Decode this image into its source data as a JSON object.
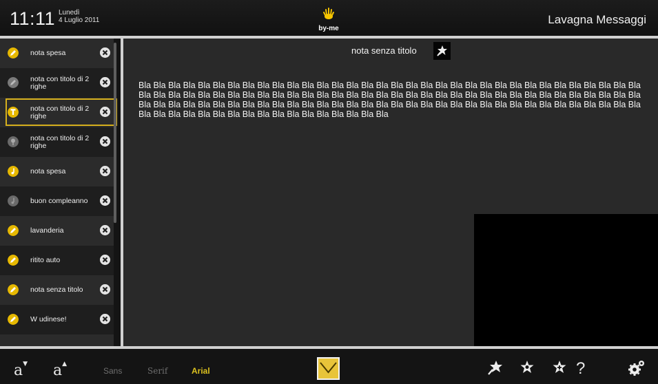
{
  "header": {
    "time": "11:11",
    "day": "Lunedì",
    "date": "4 Luglio 2011",
    "logo_text": "by-me",
    "title": "Lavagna Messaggi"
  },
  "sidebar": {
    "notes": [
      {
        "label": "nota spesa",
        "icon": "pencil-icon",
        "icon_color": "#e6b800"
      },
      {
        "label": "nota con titolo di 2 righe",
        "icon": "pencil-icon",
        "icon_color": "#7a7a7a"
      },
      {
        "label": "nota con titolo di 2 righe",
        "icon": "text-T-icon",
        "icon_color": "#e6b800",
        "selected": true
      },
      {
        "label": "nota con titolo di 2 righe",
        "icon": "pin-icon",
        "icon_color": "#6a6a6a"
      },
      {
        "label": "nota spesa",
        "icon": "music-note-icon",
        "icon_color": "#e6b800"
      },
      {
        "label": "buon compleanno",
        "icon": "music-note-icon",
        "icon_color": "#6a6a6a"
      },
      {
        "label": "lavanderia",
        "icon": "pencil-icon",
        "icon_color": "#e6b800"
      },
      {
        "label": "ritito auto",
        "icon": "pencil-icon",
        "icon_color": "#e6b800"
      },
      {
        "label": "nota senza titolo",
        "icon": "pencil-icon",
        "icon_color": "#e6b800"
      },
      {
        "label": "W udinese!",
        "icon": "pencil-icon",
        "icon_color": "#e6b800"
      }
    ]
  },
  "main": {
    "note_title": "nota senza titolo",
    "note_body": "Bla Bla Bla Bla Bla Bla Bla Bla Bla Bla Bla Bla Bla Bla Bla Bla Bla Bla Bla Bla Bla Bla Bla Bla Bla Bla Bla Bla Bla Bla Bla Bla Bla Bla Bla Bla Bla Bla Bla Bla Bla Bla Bla Bla Bla Bla Bla Bla Bla Bla Bla Bla Bla Bla Bla Bla Bla Bla Bla Bla Bla Bla Bla Bla Bla Bla Bla Bla Bla Bla Bla Bla Bla Bla Bla Bla Bla Bla Bla Bla Bla Bla Bla Bla Bla Bla Bla Bla Bla Bla Bla Bla Bla Bla Bla Bla Bla Bla Bla Bla Bla Bla Bla Bla Bla Bla Bla Bla Bla Bla Bla Bla Bla Bla Bla Bla Bla Bla Bla"
  },
  "footer": {
    "font_smaller": "a",
    "font_larger": "a",
    "font_options": [
      "Sans",
      "Serif",
      "Arial"
    ],
    "selected_font": "Arial",
    "help_label": "?"
  },
  "colors": {
    "accent": "#d6b01d",
    "background": "#292929",
    "separator": "#d0d0d0"
  }
}
